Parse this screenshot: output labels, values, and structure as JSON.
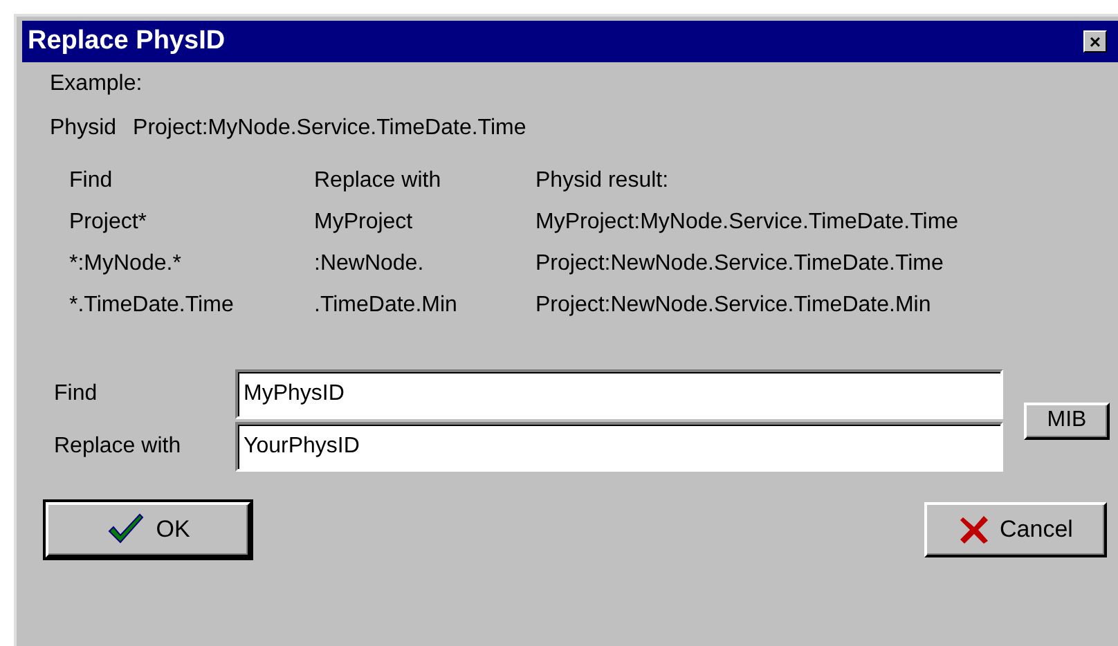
{
  "window": {
    "title": "Replace PhysID",
    "close": "×"
  },
  "example": {
    "heading": "Example:",
    "label": "Physid",
    "value": "Project:MyNode.Service.TimeDate.Time"
  },
  "table": {
    "columns": [
      "Find",
      "Replace with",
      "Physid result:"
    ],
    "rows": [
      [
        "Project*",
        "MyProject",
        "MyProject:MyNode.Service.TimeDate.Time"
      ],
      [
        "*:MyNode.*",
        ":NewNode.",
        "Project:NewNode.Service.TimeDate.Time"
      ],
      [
        "*.TimeDate.Time",
        ".TimeDate.Min",
        "Project:NewNode.Service.TimeDate.Min"
      ]
    ]
  },
  "fields": [
    {
      "label": "Find",
      "value": "MyPhysID"
    },
    {
      "label": "Replace with",
      "value": "YourPhysID"
    }
  ],
  "mib_button": "MIB",
  "buttons": [
    {
      "kind": "ok",
      "label": "OK"
    },
    {
      "kind": "cancel",
      "label": "Cancel"
    }
  ]
}
